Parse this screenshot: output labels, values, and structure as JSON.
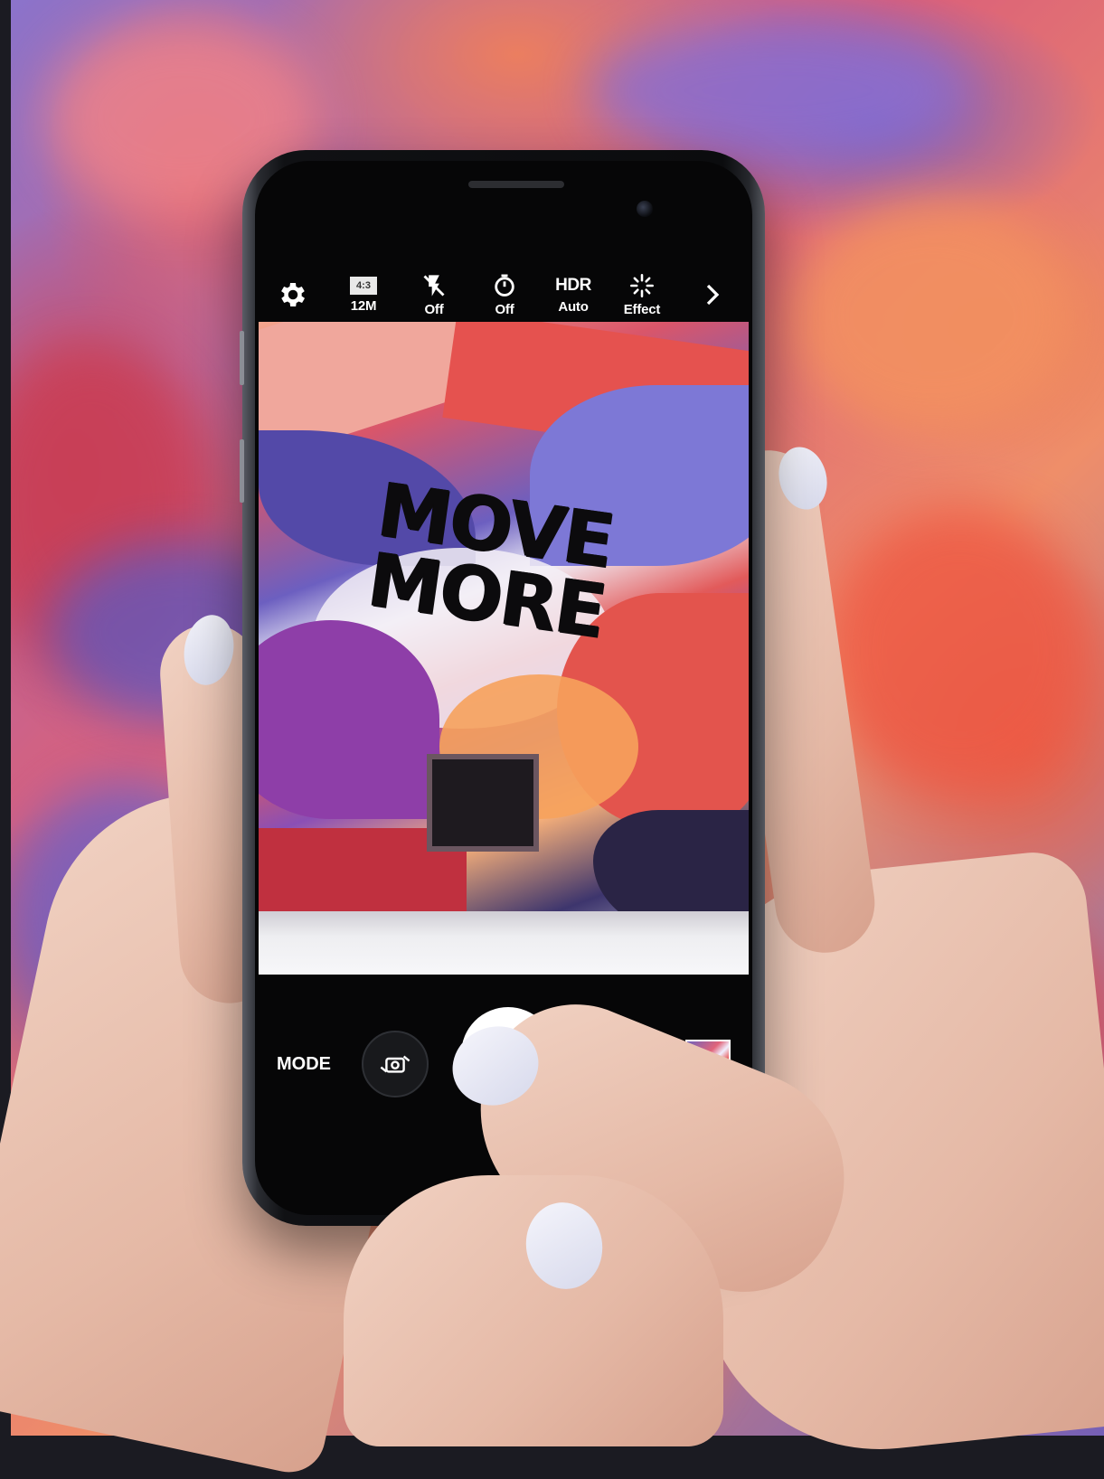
{
  "camera_app": {
    "toolbar": {
      "settings_icon": "gear-icon",
      "picture_size": {
        "ratio": "4:3",
        "label": "12M"
      },
      "flash": {
        "icon": "flash-off-icon",
        "label": "Off"
      },
      "timer": {
        "icon": "timer-icon",
        "label": "Off"
      },
      "hdr": {
        "title": "HDR",
        "label": "Auto"
      },
      "effect": {
        "icon": "sparkle-icon",
        "label": "Effect"
      },
      "more_icon": "chevron-right-icon"
    },
    "viewfinder": {
      "mural_text_line1": "MOVE",
      "mural_text_line2": "MORE"
    },
    "controls": {
      "mode_label": "MODE",
      "switch_camera_icon": "switch-camera-icon",
      "record_color": "#e23b3b"
    }
  },
  "colors": {
    "mural_purple": "#7a63b8",
    "mural_red": "#d6607a",
    "mural_orange": "#eb8f6c",
    "phone_body": "#0b0c0e",
    "skin": "#e5b9a6",
    "nail_polish": "#e6e7f2"
  }
}
